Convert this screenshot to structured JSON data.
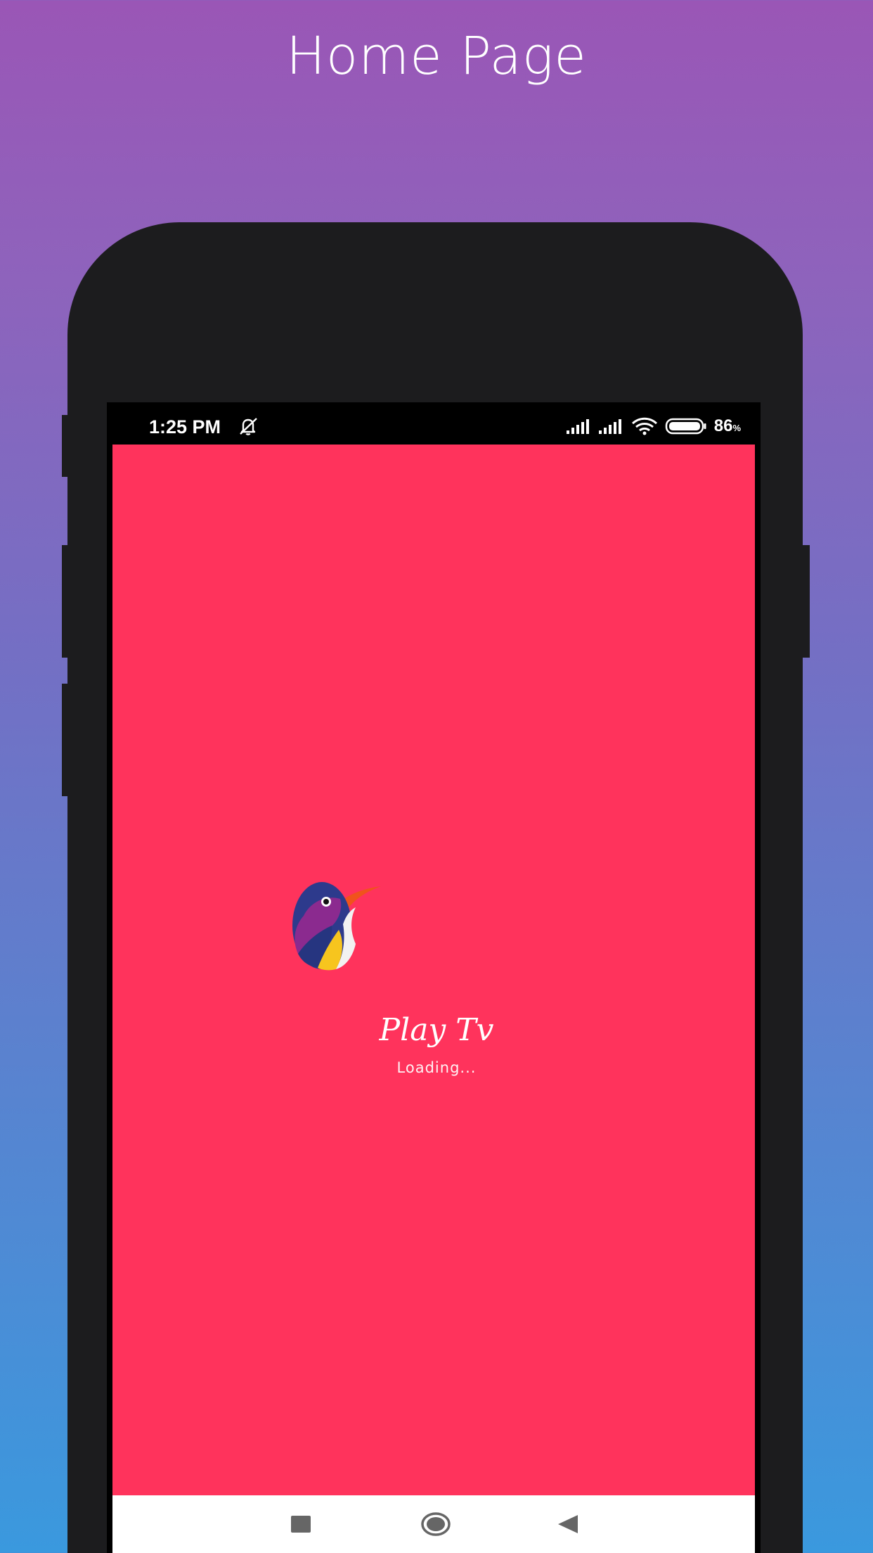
{
  "header": {
    "title": "Home Page"
  },
  "status_bar": {
    "time": "1:25 PM",
    "battery_percent": "86",
    "battery_unit": "%",
    "icons": [
      "bell-off-icon",
      "signal-icon",
      "signal-icon",
      "wifi-icon",
      "battery-icon"
    ]
  },
  "splash": {
    "app_name": "Play Tv",
    "loading_text": "Loading...",
    "logo_icon": "hummingbird-logo-icon",
    "background_color": "#ff335c"
  },
  "nav_bar": {
    "buttons": [
      "recents-button",
      "home-button",
      "back-button"
    ]
  },
  "colors": {
    "gradient_top": "#9a56b6",
    "gradient_bottom": "#3a99de",
    "phone_frame": "#1c1c1e"
  }
}
